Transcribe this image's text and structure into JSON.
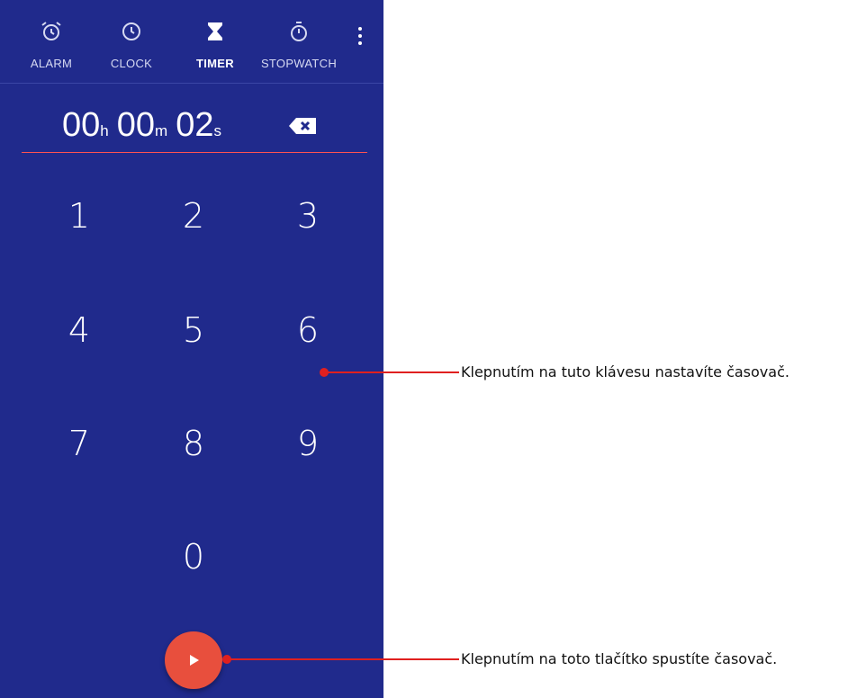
{
  "tabs": [
    {
      "label": "ALARM",
      "icon": "alarm-clock-icon"
    },
    {
      "label": "CLOCK",
      "icon": "clock-icon"
    },
    {
      "label": "TIMER",
      "icon": "hourglass-icon",
      "active": true
    },
    {
      "label": "STOPWATCH",
      "icon": "stopwatch-icon"
    }
  ],
  "menu_icon": "more-vert-icon",
  "timer": {
    "hours": "00",
    "hours_unit": "h",
    "minutes": "00",
    "minutes_unit": "m",
    "seconds": "02",
    "seconds_unit": "s",
    "backspace_icon": "backspace-icon"
  },
  "keypad": [
    "1",
    "2",
    "3",
    "4",
    "5",
    "6",
    "7",
    "8",
    "9",
    "0"
  ],
  "start_button_icon": "play-icon",
  "callouts": {
    "keypad": "Klepnutím na tuto klávesu nastavíte časovač.",
    "start": "Klepnutím na toto tlačítko spustíte časovač."
  },
  "colors": {
    "background": "#202a8c",
    "accent": "#e84f3d",
    "underline": "#ff5252",
    "callout": "#e0201f"
  }
}
